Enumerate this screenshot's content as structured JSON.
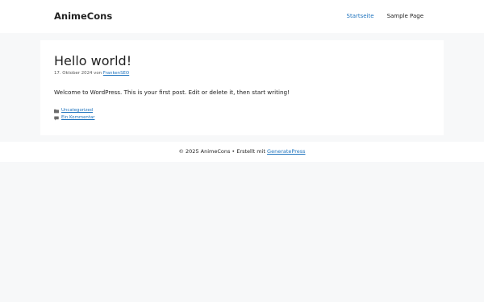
{
  "header": {
    "site_title": "AnimeCons",
    "nav": [
      {
        "label": "Startseite",
        "current": true
      },
      {
        "label": "Sample Page",
        "current": false
      }
    ]
  },
  "post": {
    "title": "Hello world!",
    "date": "17. Oktober 2024",
    "by": "von",
    "author": "FrankenSEO",
    "content": "Welcome to WordPress. This is your first post. Edit or delete it, then start writing!",
    "category": "Uncategorized",
    "comments_link": "Ein Kommentar"
  },
  "footer": {
    "copyright": "© 2025 AnimeCons • Erstellt mit",
    "credit_link": "GeneratePress"
  },
  "colors": {
    "accent": "#1e73be",
    "background": "#f7f8f9",
    "card": "#ffffff",
    "text": "#222222"
  }
}
